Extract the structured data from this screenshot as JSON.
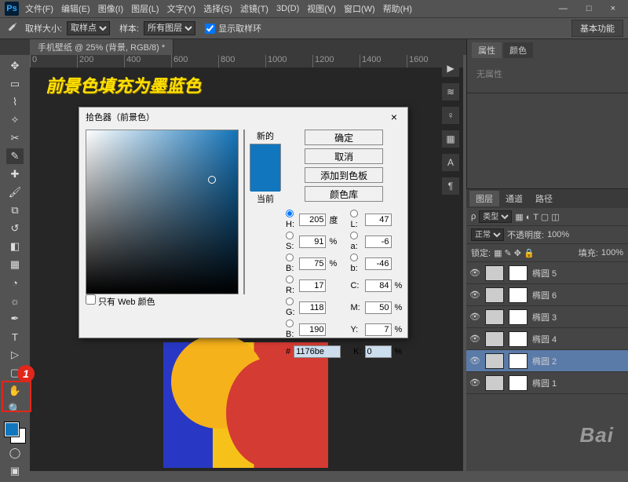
{
  "menu": {
    "items": [
      "文件(F)",
      "编辑(E)",
      "图像(I)",
      "图层(L)",
      "文字(Y)",
      "选择(S)",
      "滤镜(T)",
      "3D(D)",
      "视图(V)",
      "窗口(W)",
      "帮助(H)"
    ]
  },
  "winbtns": {
    "min": "—",
    "max": "□",
    "close": "×"
  },
  "optbar": {
    "sample_size_lbl": "取样大小:",
    "sample_size_val": "取样点",
    "sample_lbl": "样本:",
    "sample_val": "所有图层",
    "show_ring": "显示取样环",
    "basic": "基本功能"
  },
  "doc": {
    "tab": "手机壁纸 @ 25% (背景, RGB/8) *"
  },
  "ruler": [
    "0",
    "200",
    "400",
    "600",
    "800",
    "1000",
    "1200",
    "1400",
    "1600"
  ],
  "annotation": "前景色填充为墨蓝色",
  "marker": "1",
  "dialog": {
    "title": "拾色器（前景色）",
    "close": "×",
    "new_lbl": "新的",
    "cur_lbl": "当前",
    "ok": "确定",
    "cancel": "取消",
    "add": "添加到色板",
    "lib": "颜色库",
    "webonly": "只有 Web 颜色",
    "H": "205",
    "H_u": "度",
    "S": "91",
    "B": "75",
    "L": "47",
    "a": "-6",
    "b": "-46",
    "R": "17",
    "G": "118",
    "Bc": "190",
    "C": "84",
    "M": "50",
    "Y": "7",
    "K": "0",
    "hex": "1176be",
    "pct": "%"
  },
  "right": {
    "props_tab": "属性",
    "color_tab": "颜色",
    "noattr": "无属性"
  },
  "layerpanel": {
    "tabs": {
      "layers": "图层",
      "channels": "通道",
      "paths": "路径"
    },
    "kind": "类型",
    "blend": "正常",
    "opacity_lbl": "不透明度:",
    "opacity": "100%",
    "lock_lbl": "锁定:",
    "fill_lbl": "填充:",
    "fill": "100%",
    "layers": [
      {
        "name": "椭圆 5"
      },
      {
        "name": "椭圆 6"
      },
      {
        "name": "椭圆 3"
      },
      {
        "name": "椭圆 4"
      },
      {
        "name": "椭圆 2"
      },
      {
        "name": "椭圆 1"
      }
    ]
  },
  "watermark": "Bai"
}
